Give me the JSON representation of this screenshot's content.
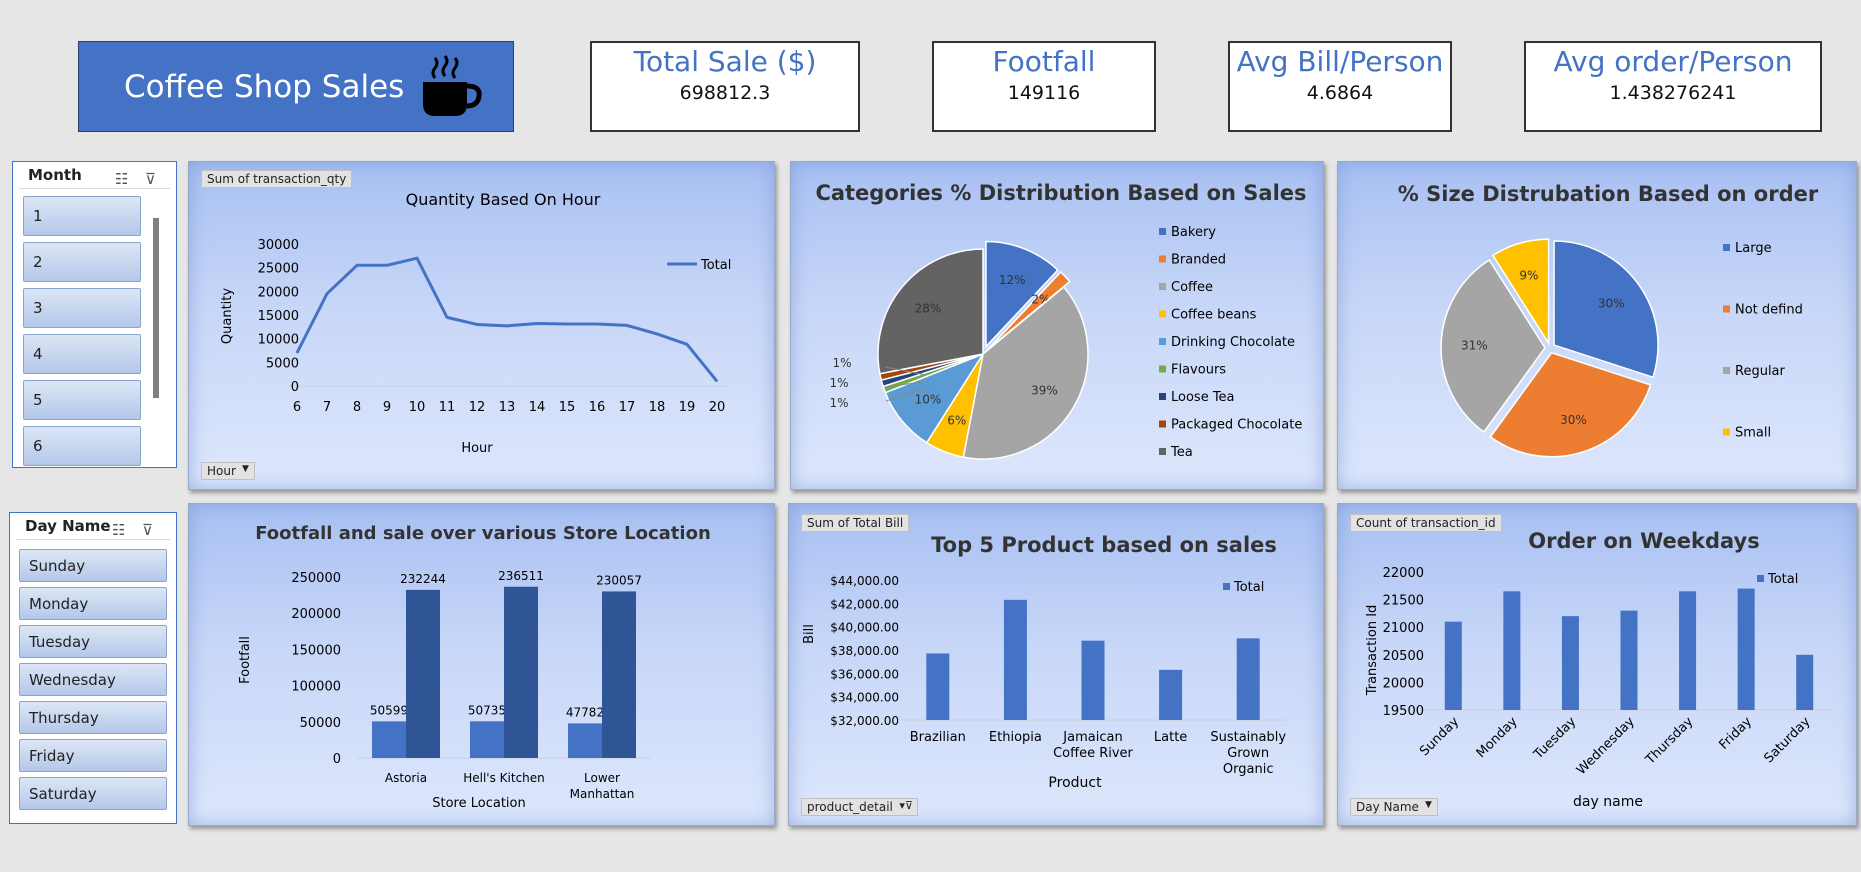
{
  "header": {
    "title": "Coffee Shop Sales",
    "kpis": [
      {
        "label": "Total Sale ($)",
        "value": "698812.3"
      },
      {
        "label": "Footfall",
        "value": "149116"
      },
      {
        "label": "Avg Bill/Person",
        "value": "4.6864"
      },
      {
        "label": "Avg order/Person",
        "value": "1.438276241"
      }
    ]
  },
  "slicers": {
    "month": {
      "title": "Month",
      "items": [
        "1",
        "2",
        "3",
        "4",
        "5",
        "6"
      ]
    },
    "day": {
      "title": "Day Name",
      "items": [
        "Sunday",
        "Monday",
        "Tuesday",
        "Wednesday",
        "Thursday",
        "Friday",
        "Saturday"
      ]
    }
  },
  "colors": {
    "accent": "#4472c4",
    "pie": [
      "#4472c4",
      "#ed7d31",
      "#a5a5a5",
      "#ffc000",
      "#5b9bd5",
      "#70ad47",
      "#264478",
      "#9e480e",
      "#636363"
    ],
    "dark_bar": "#2f5597"
  },
  "charts": {
    "hour": {
      "field_button": "Sum of transaction_qty",
      "axis_button": "Hour",
      "chart_data": {
        "type": "line",
        "title": "Quantity Based On Hour",
        "xlabel": "Hour",
        "ylabel": "Quantity",
        "x": [
          6,
          7,
          8,
          9,
          10,
          11,
          12,
          13,
          14,
          15,
          16,
          17,
          18,
          19,
          20
        ],
        "series": [
          {
            "name": "Total",
            "values": [
              7000,
              19500,
              25500,
              25500,
              27000,
              14500,
              13000,
              12700,
              13200,
              13100,
              13100,
              12800,
              11000,
              8800,
              1000
            ]
          }
        ],
        "ylim": [
          0,
          30000
        ],
        "yticks": [
          "0",
          "5000",
          "10000",
          "15000",
          "20000",
          "25000",
          "30000"
        ]
      }
    },
    "categories": {
      "chart_data": {
        "type": "pie",
        "title": "Categories % Distribution Based on Sales",
        "labels": [
          "Bakery",
          "Branded",
          "Coffee",
          "Coffee beans",
          "Drinking Chocolate",
          "Flavours",
          "Loose Tea",
          "Packaged Chocolate",
          "Tea"
        ],
        "values": [
          12,
          2,
          39,
          6,
          10,
          1,
          1,
          1,
          28
        ],
        "data_labels": [
          "12%",
          "2%",
          "39%",
          "6%",
          "10%",
          "1%",
          "1%",
          "1%",
          "28%"
        ]
      }
    },
    "size": {
      "chart_data": {
        "type": "pie",
        "title": "% Size Distrubation Based on order",
        "labels": [
          "Large",
          "Not defind",
          "Regular",
          "Small"
        ],
        "values": [
          30,
          30,
          31,
          9
        ],
        "data_labels": [
          "30%",
          "30%",
          "31%",
          "9%"
        ]
      }
    },
    "store": {
      "chart_data": {
        "type": "bar",
        "title": "Footfall and sale over various Store Location",
        "xlabel": "Store Location",
        "ylabel": "Footfall",
        "categories": [
          "Astoria",
          "Hell's Kitchen",
          "Lower Manhattan"
        ],
        "series": [
          {
            "values": [
              50599,
              50735,
              47782
            ]
          },
          {
            "values": [
              232244,
              236511,
              230057
            ]
          }
        ],
        "ylim": [
          0,
          250000
        ],
        "yticks": [
          "0",
          "50000",
          "100000",
          "150000",
          "200000",
          "250000"
        ]
      }
    },
    "product": {
      "field_button": "Sum of Total Bill",
      "axis_button": "product_detail",
      "chart_data": {
        "type": "bar",
        "title": "Top 5 Product based on sales",
        "xlabel": "Product",
        "ylabel": "Bill",
        "categories": [
          "Brazilian",
          "Ethiopia",
          "Jamaican Coffee River",
          "Latte",
          "Sustainably Grown Organic"
        ],
        "series": [
          {
            "name": "Total",
            "values": [
              37700,
              42300,
              38800,
              36300,
              39000
            ]
          }
        ],
        "ylim": [
          32000,
          44000
        ],
        "yticks": [
          "$32,000.00",
          "$34,000.00",
          "$36,000.00",
          "$38,000.00",
          "$40,000.00",
          "$42,000.00",
          "$44,000.00"
        ]
      }
    },
    "weekday": {
      "field_button": "Count of transaction_id",
      "axis_button": "Day Name",
      "chart_data": {
        "type": "bar",
        "title": "Order on Weekdays",
        "xlabel": "day name",
        "ylabel": "Transaction Id",
        "categories": [
          "Sunday",
          "Monday",
          "Tuesday",
          "Wednesday",
          "Thursday",
          "Friday",
          "Saturday"
        ],
        "series": [
          {
            "name": "Total",
            "values": [
              21100,
              21650,
              21200,
              21300,
              21650,
              21700,
              20500
            ]
          }
        ],
        "ylim": [
          19500,
          22000
        ],
        "yticks": [
          "19500",
          "20000",
          "20500",
          "21000",
          "21500",
          "22000"
        ]
      }
    }
  }
}
